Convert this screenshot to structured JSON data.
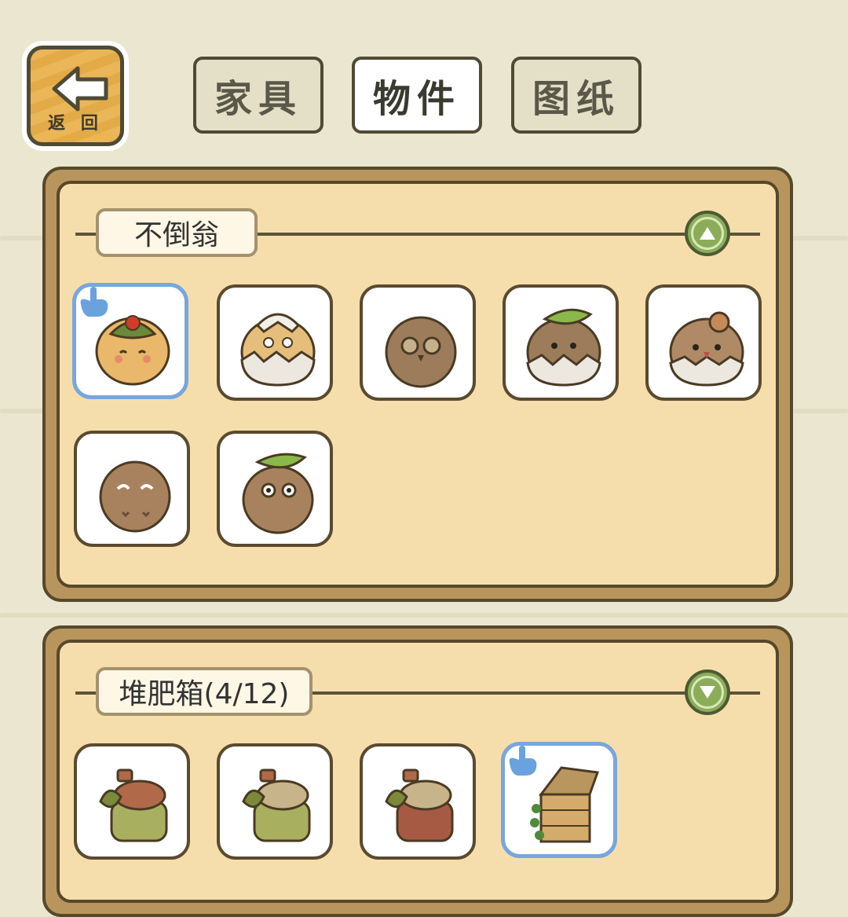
{
  "back": {
    "label": "返 回",
    "icon": "left-arrow-icon"
  },
  "tabs": [
    {
      "label": "家具",
      "active": false
    },
    {
      "label": "物件",
      "active": true
    },
    {
      "label": "图纸",
      "active": false
    }
  ],
  "sections": [
    {
      "title": "不倒翁",
      "toggle": "chevron-up-icon",
      "items": [
        {
          "name": "tumbler-berry-leaf",
          "selected": true
        },
        {
          "name": "tumbler-flower-hat",
          "selected": false
        },
        {
          "name": "tumbler-owl",
          "selected": false
        },
        {
          "name": "tumbler-leaf-eggshell",
          "selected": false
        },
        {
          "name": "tumbler-mushroom-eggshell",
          "selected": false
        },
        {
          "name": "tumbler-plain",
          "selected": false
        },
        {
          "name": "tumbler-leaf-wide-eyes",
          "selected": false
        }
      ]
    },
    {
      "title": "堆肥箱(4/12)",
      "toggle": "chevron-down-icon",
      "items": [
        {
          "name": "compost-stump-brown",
          "selected": false
        },
        {
          "name": "compost-stump-green",
          "selected": false
        },
        {
          "name": "compost-stump-red",
          "selected": false
        },
        {
          "name": "compost-crate",
          "selected": true
        }
      ]
    }
  ],
  "colors": {
    "background": "#ebe6cf",
    "panel_frame": "#b9955e",
    "panel_fill": "#f6deac",
    "selected_outline": "#78a6de",
    "toggle_green": "#8cac5a"
  }
}
